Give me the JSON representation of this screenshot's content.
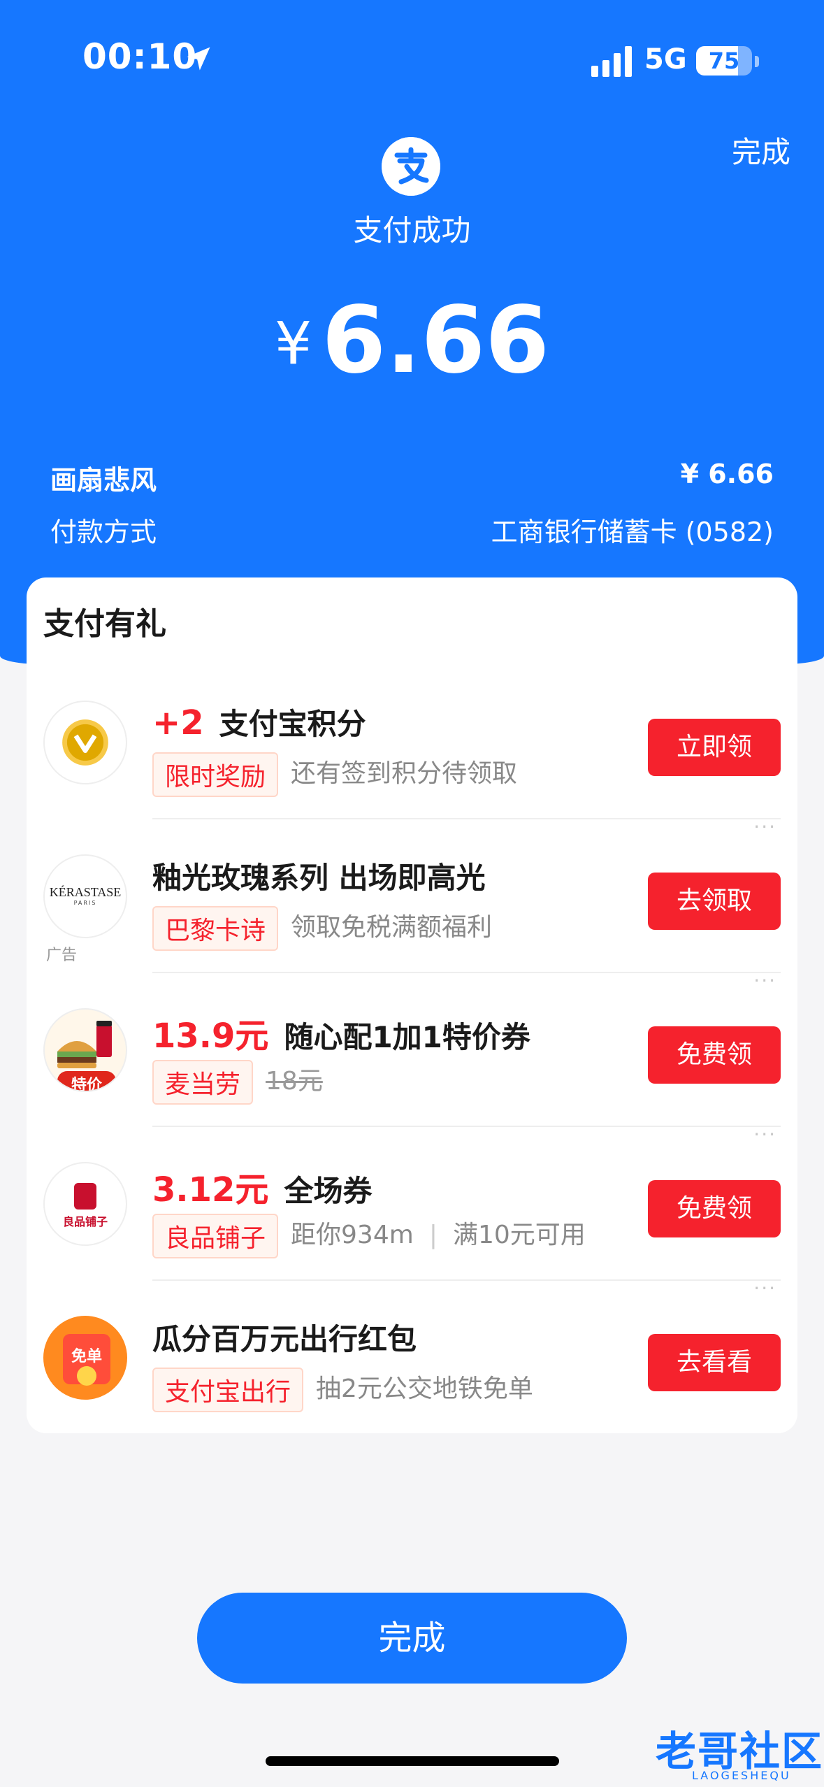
{
  "status_bar": {
    "time": "00:10",
    "network": "5G",
    "battery": "75",
    "battery_level": 0.75
  },
  "header": {
    "done_label": "完成",
    "success_text": "支付成功",
    "currency_symbol": "¥",
    "amount": "6.66"
  },
  "details": {
    "merchant_name": "画扇悲风",
    "merchant_amount": "¥ 6.66",
    "payment_method_label": "付款方式",
    "payment_method_value": "工商银行储蓄卡 (0582)"
  },
  "rewards": {
    "title": "支付有礼",
    "items": [
      {
        "highlight": "+2",
        "title": "支付宝积分",
        "tag": "限时奖励",
        "desc": "还有签到积分待领取",
        "button": "立即领",
        "icon": "alipay-points-badge-icon"
      },
      {
        "highlight": "",
        "title": "釉光玫瑰系列 出场即高光",
        "tag": "巴黎卡诗",
        "desc": "领取免税满额福利",
        "button": "去领取",
        "ad_label": "广告",
        "icon_text": "KÉRASTASE",
        "icon_sub": "PARIS",
        "icon": "kerastase-logo-icon"
      },
      {
        "highlight": "13.9元",
        "title": "随心配1加1特价券",
        "tag": "麦当劳",
        "desc": "18元",
        "button": "免费领",
        "icon_text": "特价",
        "icon": "mcdonalds-burger-icon"
      },
      {
        "highlight": "3.12元",
        "title": "全场券",
        "tag": "良品铺子",
        "desc": "距你934m",
        "desc2": "满10元可用",
        "button": "免费领",
        "icon_text": "良品铺子",
        "icon": "bestore-logo-icon"
      },
      {
        "highlight": "",
        "title": "瓜分百万元出行红包",
        "tag": "支付宝出行",
        "desc": "抽2元公交地铁免单",
        "button": "去看看",
        "icon_text": "免单",
        "icon": "red-envelope-icon"
      }
    ]
  },
  "footer": {
    "done_label": "完成",
    "watermark": "老哥社区",
    "watermark_sub": "LAOGESHEQU"
  }
}
